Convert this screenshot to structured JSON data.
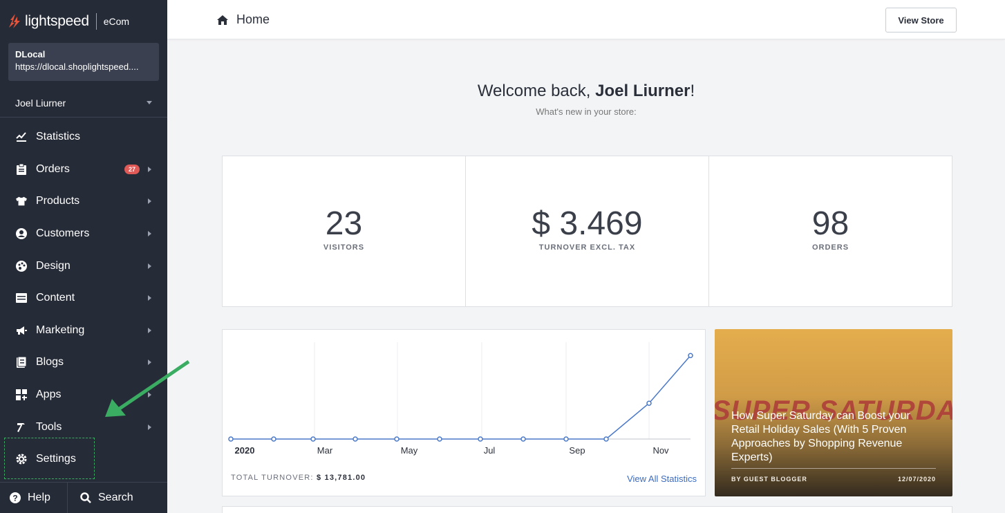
{
  "brand": {
    "name": "lightspeed",
    "product": "eCom",
    "accent": "#e8543a"
  },
  "store": {
    "name": "DLocal",
    "url": "https://dlocal.shoplightspeed...."
  },
  "user": {
    "name": "Joel Liurner"
  },
  "nav": {
    "items": [
      {
        "label": "Statistics",
        "icon": "chart-icon"
      },
      {
        "label": "Orders",
        "icon": "clipboard-icon",
        "badge": "27"
      },
      {
        "label": "Products",
        "icon": "shirt-icon"
      },
      {
        "label": "Customers",
        "icon": "user-circle-icon"
      },
      {
        "label": "Design",
        "icon": "palette-icon"
      },
      {
        "label": "Content",
        "icon": "content-icon"
      },
      {
        "label": "Marketing",
        "icon": "megaphone-icon"
      },
      {
        "label": "Blogs",
        "icon": "blog-icon"
      },
      {
        "label": "Apps",
        "icon": "apps-icon"
      },
      {
        "label": "Tools",
        "icon": "hammer-icon"
      },
      {
        "label": "Settings",
        "icon": "gear-icon"
      }
    ],
    "help": "Help",
    "search": "Search"
  },
  "header": {
    "breadcrumb": "Home",
    "view_store": "View Store"
  },
  "welcome": {
    "prefix": "Welcome back, ",
    "name": "Joel Liurner",
    "suffix": "!",
    "subtitle": "What's new in your store:"
  },
  "kpis": [
    {
      "value": "23",
      "label": "VISITORS"
    },
    {
      "value": "$ 3.469",
      "label": "TURNOVER EXCL. TAX"
    },
    {
      "value": "98",
      "label": "ORDERS"
    }
  ],
  "chart_data": {
    "type": "line",
    "x_tick_labels": [
      "2020",
      "Mar",
      "May",
      "Jul",
      "Sep",
      "Nov"
    ],
    "series": [
      {
        "values": [
          0,
          0,
          0,
          0,
          0,
          0,
          0,
          0,
          0,
          0,
          3,
          7
        ]
      }
    ],
    "grid": true,
    "footer_label": "TOTAL TURNOVER:",
    "footer_value": "$ 13,781.00",
    "link": "View All Statistics"
  },
  "blog": {
    "background_text": "SUPER SATURDAY",
    "title": "How Super Saturday can Boost your Retail Holiday Sales (With 5 Proven Approaches by Shopping Revenue Experts)",
    "author": "BY GUEST BLOGGER",
    "date": "12/07/2020"
  }
}
